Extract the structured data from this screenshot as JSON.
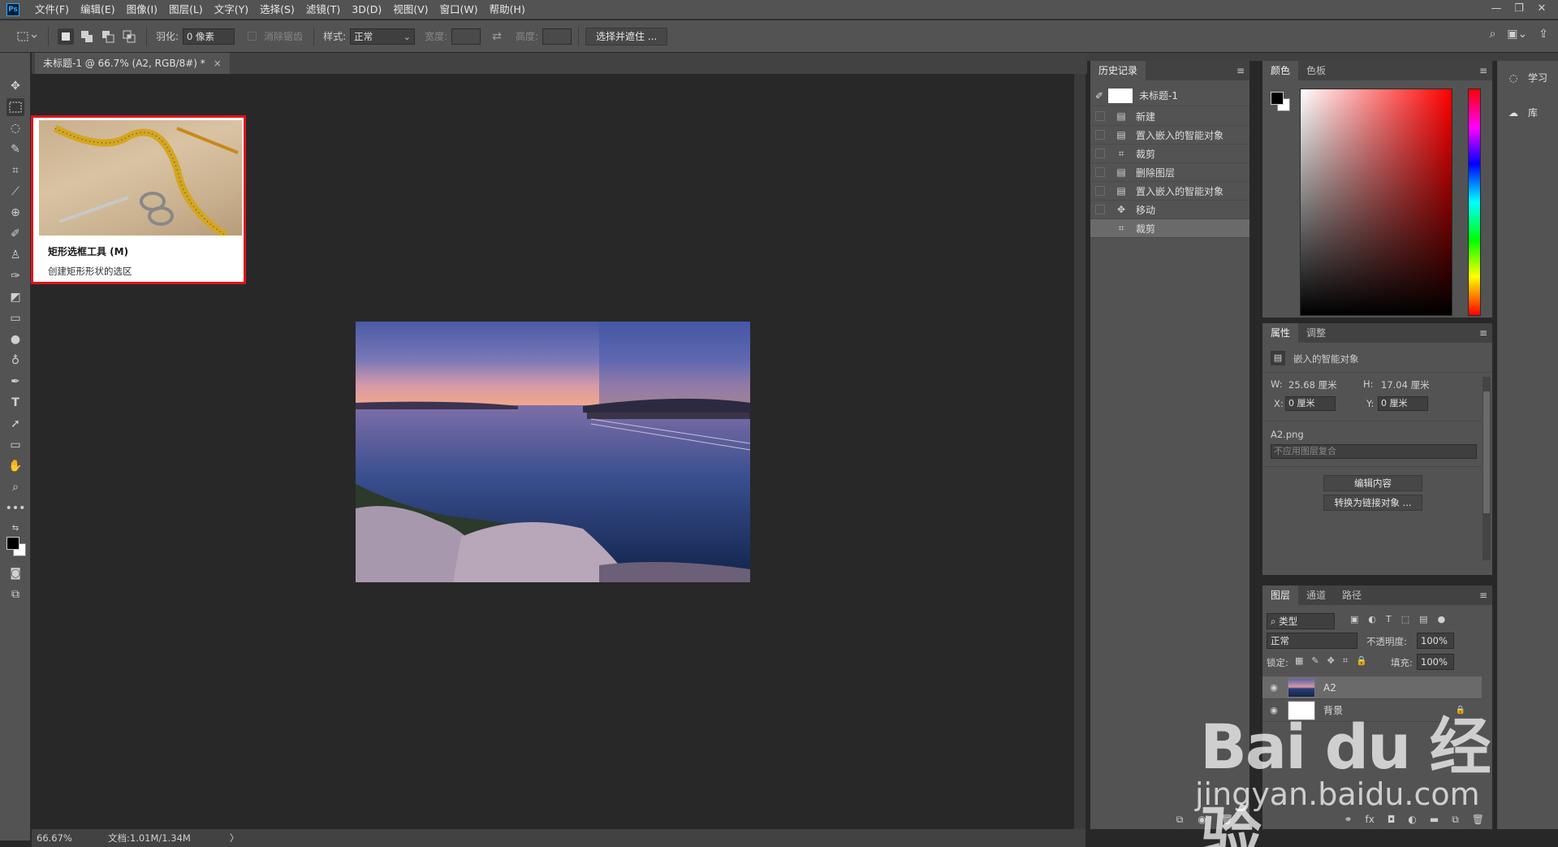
{
  "app": {
    "logo": "Ps"
  },
  "menu": [
    "文件(F)",
    "编辑(E)",
    "图像(I)",
    "图层(L)",
    "文字(Y)",
    "选择(S)",
    "滤镜(T)",
    "3D(D)",
    "视图(V)",
    "窗口(W)",
    "帮助(H)"
  ],
  "window_controls": {
    "minimize": "—",
    "restore": "❐",
    "close": "✕"
  },
  "options": {
    "feather_label": "羽化:",
    "feather_value": "0 像素",
    "antialias_label": "消除锯齿",
    "style_label": "样式:",
    "style_value": "正常",
    "width_label": "宽度:",
    "height_label": "高度:",
    "select_mask_button": "选择并遮住 ..."
  },
  "document": {
    "tab_title": "未标题-1 @ 66.7% (A2, RGB/8#) *",
    "close_glyph": "×"
  },
  "tooltip": {
    "title": "矩形选框工具 (M)",
    "description": "创建矩形形状的选区"
  },
  "status": {
    "zoom": "66.67%",
    "doc_info": "文档:1.01M/1.34M",
    "arrow": "〉"
  },
  "history": {
    "tab": "历史记录",
    "snapshot": "未标题-1",
    "items": [
      {
        "label": "新建",
        "icon": "document-icon",
        "glyph": "▤"
      },
      {
        "label": "置入嵌入的智能对象",
        "icon": "document-icon",
        "glyph": "▤"
      },
      {
        "label": "裁剪",
        "icon": "crop-icon",
        "glyph": "⌗"
      },
      {
        "label": "删除图层",
        "icon": "document-icon",
        "glyph": "▤"
      },
      {
        "label": "置入嵌入的智能对象",
        "icon": "document-icon",
        "glyph": "▤"
      },
      {
        "label": "移动",
        "icon": "move-icon",
        "glyph": "✥"
      },
      {
        "label": "裁剪",
        "icon": "crop-icon",
        "glyph": "⌗"
      }
    ],
    "active_index": 6
  },
  "color_panel": {
    "tabs": [
      "颜色",
      "色板"
    ],
    "foreground": "#000000",
    "background": "#ffffff",
    "hue": "#ff0000"
  },
  "properties": {
    "tabs": [
      "属性",
      "调整"
    ],
    "type_label": "嵌入的智能对象",
    "w_label": "W:",
    "w_value": "25.68 厘米",
    "h_label": "H:",
    "h_value": "17.04 厘米",
    "x_label": "X:",
    "x_value": "0 厘米",
    "y_label": "Y:",
    "y_value": "0 厘米",
    "filename": "A2.png",
    "comp_select": "不应用图层复合",
    "edit_button": "编辑内容",
    "convert_button": "转换为链接对象 ..."
  },
  "layers": {
    "tabs": [
      "图层",
      "通道",
      "路径"
    ],
    "filter_kind": "类型",
    "blend_mode": "正常",
    "opacity_label": "不透明度:",
    "opacity_value": "100%",
    "lock_label": "锁定:",
    "fill_label": "填充:",
    "fill_value": "100%",
    "items": [
      {
        "name": "A2",
        "selected": true
      },
      {
        "name": "背景",
        "selected": false,
        "locked": true
      }
    ]
  },
  "right_strip": {
    "learn": "学习",
    "libraries": "库"
  },
  "watermark": {
    "brand": "Bai du 经验",
    "url": "jingyan.baidu.com"
  }
}
